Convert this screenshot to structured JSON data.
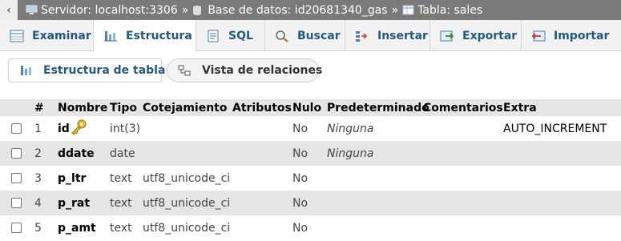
{
  "breadcrumb": {
    "server": "Servidor: localhost:3306",
    "database": "Base de datos: id20681340_gas",
    "table": "Tabla: sales",
    "separator": "»"
  },
  "tabs": [
    {
      "label": "Examinar",
      "icon": "browse-icon"
    },
    {
      "label": "Estructura",
      "icon": "structure-icon"
    },
    {
      "label": "SQL",
      "icon": "sql-icon"
    },
    {
      "label": "Buscar",
      "icon": "search-icon"
    },
    {
      "label": "Insertar",
      "icon": "insert-icon"
    },
    {
      "label": "Exportar",
      "icon": "export-icon"
    },
    {
      "label": "Importar",
      "icon": "import-icon"
    }
  ],
  "subnav": {
    "structure": "Estructura de tabla",
    "relations": "Vista de relaciones"
  },
  "columns": [
    "#",
    "Nombre",
    "Tipo",
    "Cotejamiento",
    "Atributos",
    "Nulo",
    "Predeterminado",
    "Comentarios",
    "Extra"
  ],
  "rows": [
    {
      "n": "1",
      "name": "id",
      "type": "int(3)",
      "collation": "",
      "null": "No",
      "default": "Ninguna",
      "extra": "AUTO_INCREMENT"
    },
    {
      "n": "2",
      "name": "ddate",
      "type": "date",
      "collation": "",
      "null": "No",
      "default": "Ninguna",
      "extra": ""
    },
    {
      "n": "3",
      "name": "p_ltr",
      "type": "text",
      "collation": "utf8_unicode_ci",
      "null": "No",
      "default": "",
      "extra": ""
    },
    {
      "n": "4",
      "name": "p_rat",
      "type": "text",
      "collation": "utf8_unicode_ci",
      "null": "No",
      "default": "",
      "extra": ""
    },
    {
      "n": "5",
      "name": "p_amt",
      "type": "text",
      "collation": "utf8_unicode_ci",
      "null": "No",
      "default": "",
      "extra": ""
    }
  ]
}
